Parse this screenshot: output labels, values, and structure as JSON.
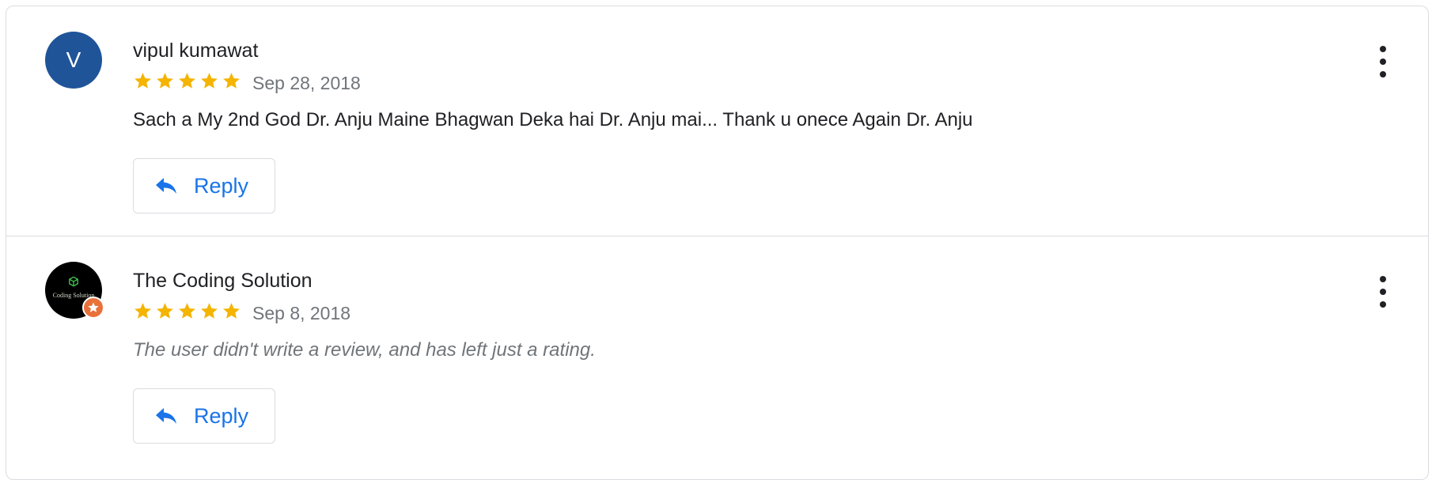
{
  "reviews": [
    {
      "author": "vipul kumawat",
      "avatar_letter": "V",
      "avatar_color": "#1f5499",
      "rating": 5,
      "date": "Sep 28, 2018",
      "text": "Sach a My 2nd God Dr. Anju Maine Bhagwan Deka hai Dr. Anju mai... Thank u onece Again Dr. Anju",
      "reply_label": "Reply"
    },
    {
      "author": "The Coding Solution",
      "avatar_logo_text": "Coding Solution",
      "avatar_color": "#000000",
      "badge_color": "#e8713a",
      "rating": 5,
      "date": "Sep 8, 2018",
      "text": "The user didn't write a review, and has left just a rating.",
      "reply_label": "Reply"
    }
  ],
  "colors": {
    "star": "#f4b400",
    "accent": "#1a73e8",
    "border": "#dadce0"
  },
  "icons": {
    "star": "star-icon",
    "reply": "reply-arrow-icon",
    "more": "more-vert-icon",
    "badge": "local-guide-badge-icon"
  }
}
